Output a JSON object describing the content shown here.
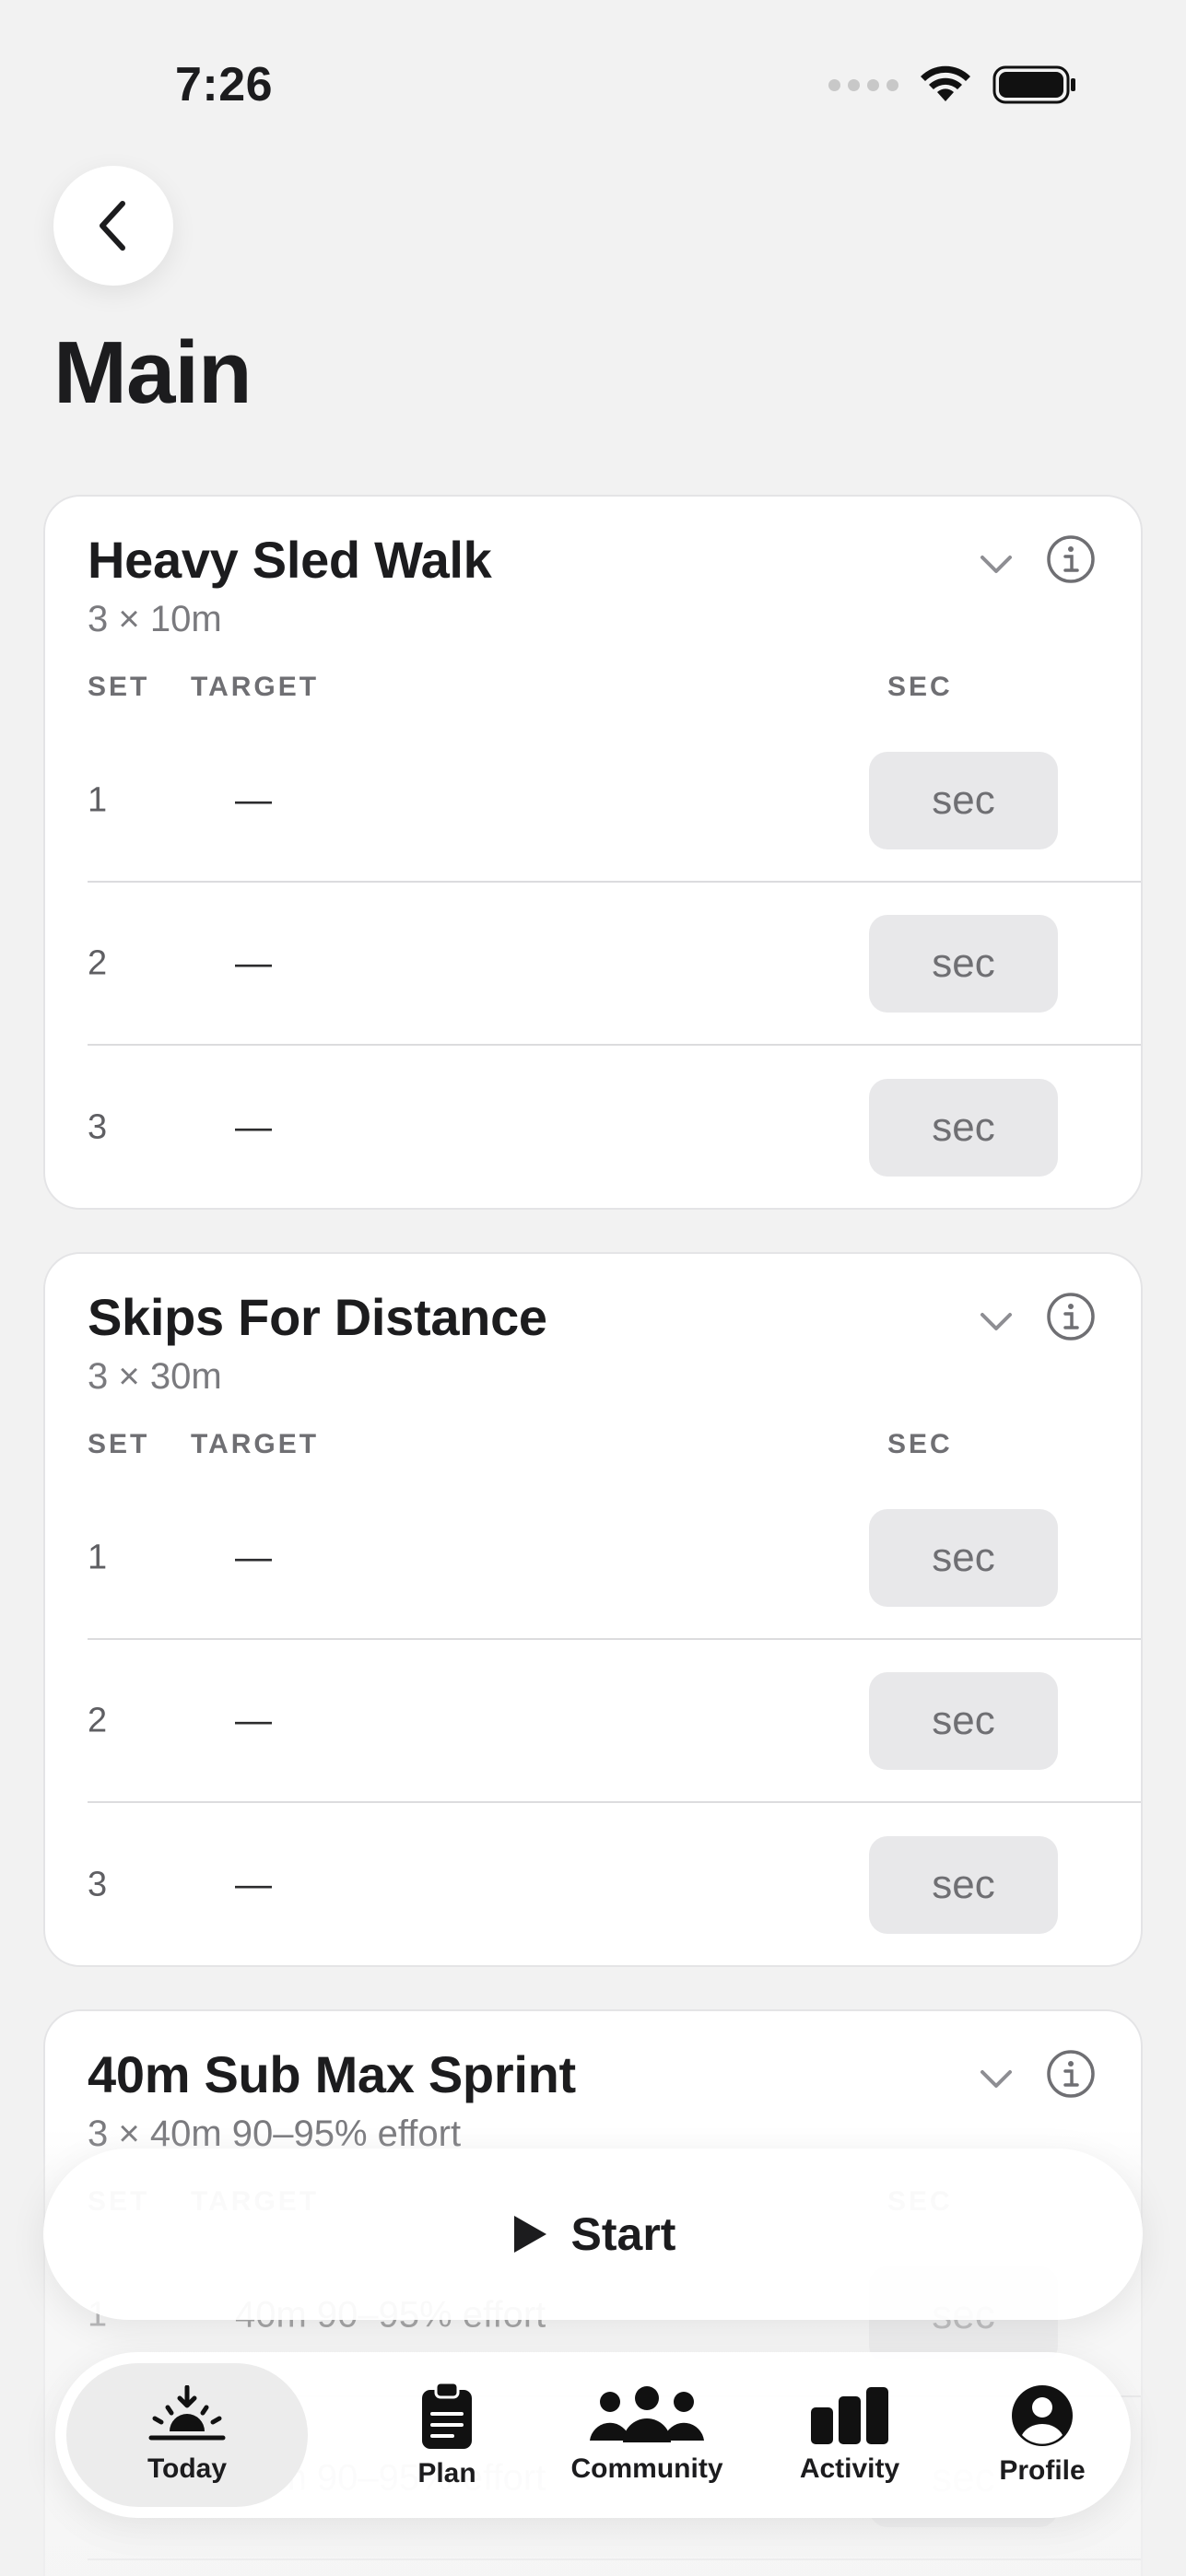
{
  "status_bar": {
    "time": "7:26"
  },
  "header": {
    "title": "Main"
  },
  "columns": {
    "set": "SET",
    "target": "TARGET",
    "sec": "SEC"
  },
  "exercises": [
    {
      "name": "Heavy Sled Walk",
      "prescription": "3 × 10m",
      "rows": [
        {
          "set": "1",
          "target": "—",
          "sec_placeholder": "sec"
        },
        {
          "set": "2",
          "target": "—",
          "sec_placeholder": "sec"
        },
        {
          "set": "3",
          "target": "—",
          "sec_placeholder": "sec"
        }
      ]
    },
    {
      "name": "Skips For Distance",
      "prescription": "3 × 30m",
      "rows": [
        {
          "set": "1",
          "target": "—",
          "sec_placeholder": "sec"
        },
        {
          "set": "2",
          "target": "—",
          "sec_placeholder": "sec"
        },
        {
          "set": "3",
          "target": "—",
          "sec_placeholder": "sec"
        }
      ]
    },
    {
      "name": "40m Sub Max Sprint",
      "prescription": "3 × 40m 90–95% effort",
      "rows": [
        {
          "set": "1",
          "target": "40m 90–95% effort",
          "sec_placeholder": "sec"
        },
        {
          "set": "2",
          "target": "40m 90–95% effort",
          "sec_placeholder": "sec"
        }
      ]
    }
  ],
  "start_button": {
    "label": "Start"
  },
  "tabbar": {
    "tabs": [
      {
        "label": "Today",
        "icon": "sunrise-icon",
        "selected": true
      },
      {
        "label": "Plan",
        "icon": "clipboard-icon"
      },
      {
        "label": "Community",
        "icon": "people-icon"
      },
      {
        "label": "Activity",
        "icon": "bar-chart-icon"
      },
      {
        "label": "Profile",
        "icon": "person-circle-icon"
      }
    ]
  },
  "colors": {
    "background": "#f2f2f2",
    "card": "#ffffff",
    "sec_field": "#e8e8ea",
    "text": "#1c1c1e",
    "muted": "#7a7a7e"
  }
}
